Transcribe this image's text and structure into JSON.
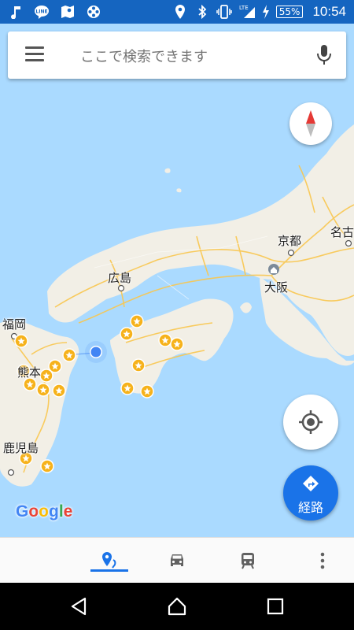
{
  "status_bar": {
    "left_icons": [
      "music-note-icon",
      "line-app-icon",
      "maps-app-icon",
      "film-reel-icon"
    ],
    "right_icons": [
      "location-icon",
      "bluetooth-icon",
      "vibrate-icon",
      "lte-signal-icon",
      "charging-icon"
    ],
    "network": "LTE",
    "battery": "55%",
    "time": "10:54"
  },
  "search": {
    "placeholder": "ここで検索できます"
  },
  "map": {
    "cities": [
      "福岡",
      "熊本",
      "鹿児島",
      "広島",
      "京都",
      "大阪",
      "名古"
    ],
    "attribution": "Google",
    "colors": {
      "sea": "#aadaff",
      "land": "#f2efe6",
      "road": "#f9c74f",
      "marker": "#f6b21b",
      "my_location": "#4285f4"
    }
  },
  "buttons": {
    "route_label": "経路"
  },
  "tabs": [
    {
      "name": "explore",
      "icon": "place-icon",
      "active": true
    },
    {
      "name": "driving",
      "icon": "car-icon",
      "active": false
    },
    {
      "name": "transit",
      "icon": "train-icon",
      "active": false
    },
    {
      "name": "more",
      "icon": "more-vert-icon",
      "active": false
    }
  ],
  "accent_color": "#1a73e8"
}
